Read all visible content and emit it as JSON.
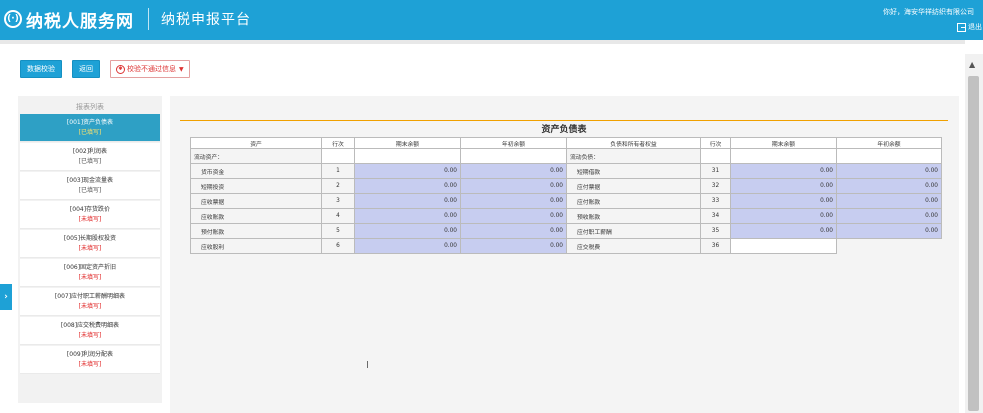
{
  "header": {
    "logo_glyph": "(·)",
    "brand": "纳税人服务网",
    "platform": "纳税申报平台",
    "greeting": "你好，海安华祥纺织有限公司",
    "logout_label": "退出"
  },
  "toolbar": {
    "validate_label": "数据校验",
    "back_label": "返回",
    "error_info_label": "校验不通过信息"
  },
  "sidebar": {
    "title": "报表列表",
    "items": [
      {
        "label": "[001]资产负债表",
        "status": "[已填写]",
        "status_type": "done",
        "active": true
      },
      {
        "label": "[002]利润表",
        "status": "[已填写]",
        "status_type": "done",
        "active": false
      },
      {
        "label": "[003]现金流量表",
        "status": "[已填写]",
        "status_type": "done",
        "active": false
      },
      {
        "label": "[004]存货跌价",
        "status": "[未填写]",
        "status_type": "todo",
        "active": false
      },
      {
        "label": "[005]长期股权投资",
        "status": "[未填写]",
        "status_type": "todo",
        "active": false
      },
      {
        "label": "[006]固定资产折旧",
        "status": "[未填写]",
        "status_type": "todo",
        "active": false
      },
      {
        "label": "[007]应付职工薪酬明细表",
        "status": "[未填写]",
        "status_type": "todo",
        "active": false
      },
      {
        "label": "[008]应交税费明细表",
        "status": "[未填写]",
        "status_type": "todo",
        "active": false
      },
      {
        "label": "[009]利润分配表",
        "status": "[未填写]",
        "status_type": "todo",
        "active": false
      }
    ],
    "toggle_glyph": "›"
  },
  "sheet": {
    "title": "资产负债表",
    "headers": [
      "资产",
      "行次",
      "期末余额",
      "年初余额",
      "负债和所有者权益",
      "行次",
      "期末余额",
      "年初余额"
    ],
    "section_left": "流动资产：",
    "section_right": "流动负债：",
    "rows": [
      {
        "lname": "货币资金",
        "lline": "1",
        "lend": "0.00",
        "lbegin": "0.00",
        "rname": "短期借款",
        "rline": "31",
        "rend": "0.00",
        "rbegin": "0.00"
      },
      {
        "lname": "短期投资",
        "lline": "2",
        "lend": "0.00",
        "lbegin": "0.00",
        "rname": "应付票据",
        "rline": "32",
        "rend": "0.00",
        "rbegin": "0.00"
      },
      {
        "lname": "应收票据",
        "lline": "3",
        "lend": "0.00",
        "lbegin": "0.00",
        "rname": "应付账款",
        "rline": "33",
        "rend": "0.00",
        "rbegin": "0.00"
      },
      {
        "lname": "应收账款",
        "lline": "4",
        "lend": "0.00",
        "lbegin": "0.00",
        "rname": "预收账款",
        "rline": "34",
        "rend": "0.00",
        "rbegin": "0.00"
      },
      {
        "lname": "预付账款",
        "lline": "5",
        "lend": "0.00",
        "lbegin": "0.00",
        "rname": "应付职工薪酬",
        "rline": "35",
        "rend": "0.00",
        "rbegin": "0.00"
      },
      {
        "lname": "应收股利",
        "lline": "6",
        "lend": "0.00",
        "lbegin": "0.00",
        "rname": "应交税费",
        "rline": "36",
        "rend": "",
        "rbegin": ""
      }
    ]
  },
  "colors": {
    "brand_blue": "#1ea1d6",
    "input_cell": "#c7cdf0",
    "status_todo": "#e02020"
  }
}
